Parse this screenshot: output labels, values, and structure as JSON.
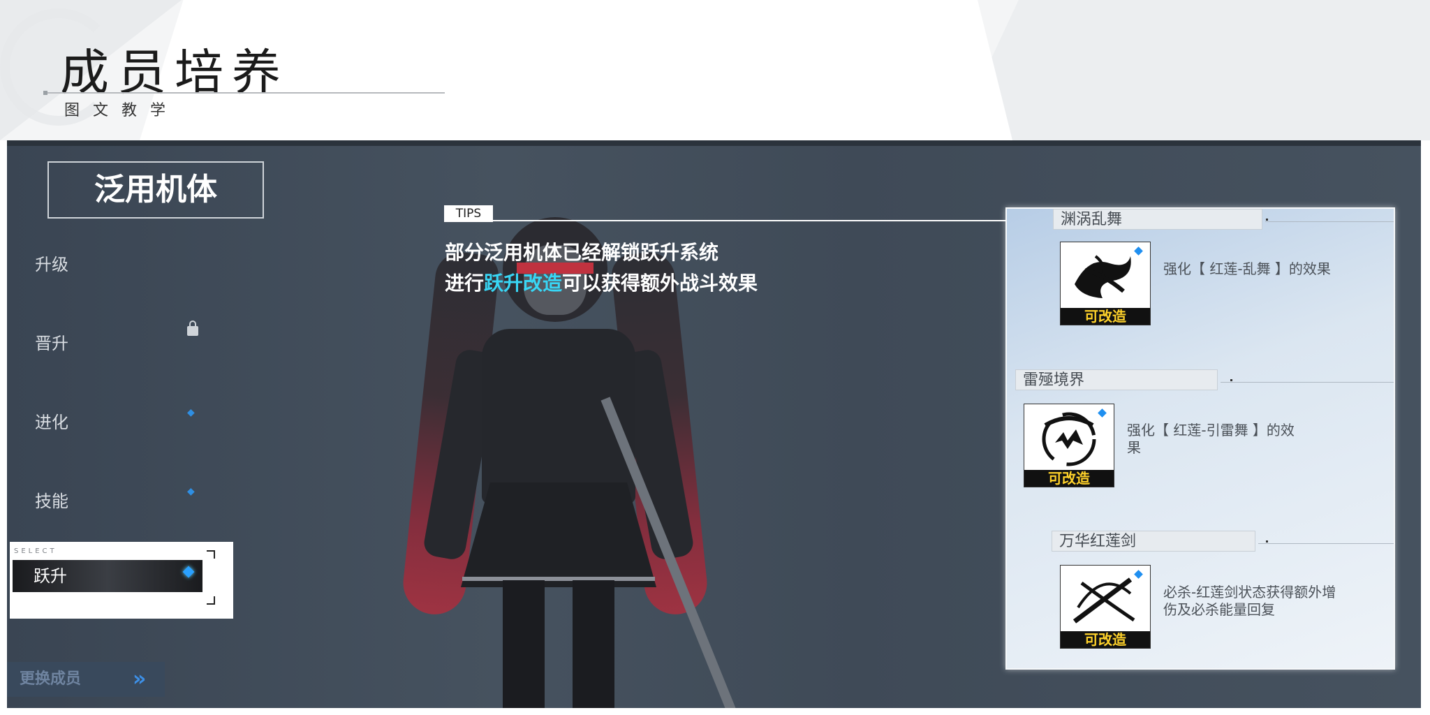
{
  "header": {
    "title": "成员培养",
    "subtitle": "图文教学"
  },
  "left_menu": {
    "panel_title": "泛用机体",
    "items": [
      {
        "label": "升级"
      },
      {
        "label": "晋升"
      },
      {
        "label": "进化"
      },
      {
        "label": "技能"
      }
    ],
    "select": {
      "caption": "SELECT",
      "label": "跃升"
    },
    "change_member": "更换成员",
    "change_arrow": "»"
  },
  "tips": {
    "tag": "TIPS",
    "line1": "部分泛用机体已经解锁跃升系统",
    "line2_prefix": "进行",
    "line2_highlight": "跃升改造",
    "line2_suffix": "可以获得额外战斗效果"
  },
  "skills": [
    {
      "name": "渊涡乱舞",
      "tag": "可改造",
      "desc": "强化【 红莲-乱舞 】的效果"
    },
    {
      "name": "雷殛境界",
      "tag": "可改造",
      "desc": "强化【 红莲-引雷舞 】的效果"
    },
    {
      "name": "万华红莲剑",
      "tag": "可改造",
      "desc": "必杀-红莲剑状态获得额外增伤及必杀能量回复"
    }
  ],
  "colors": {
    "highlight": "#38d6f5",
    "tag_text": "#ffd22a",
    "gem": "#1f8ff0"
  }
}
